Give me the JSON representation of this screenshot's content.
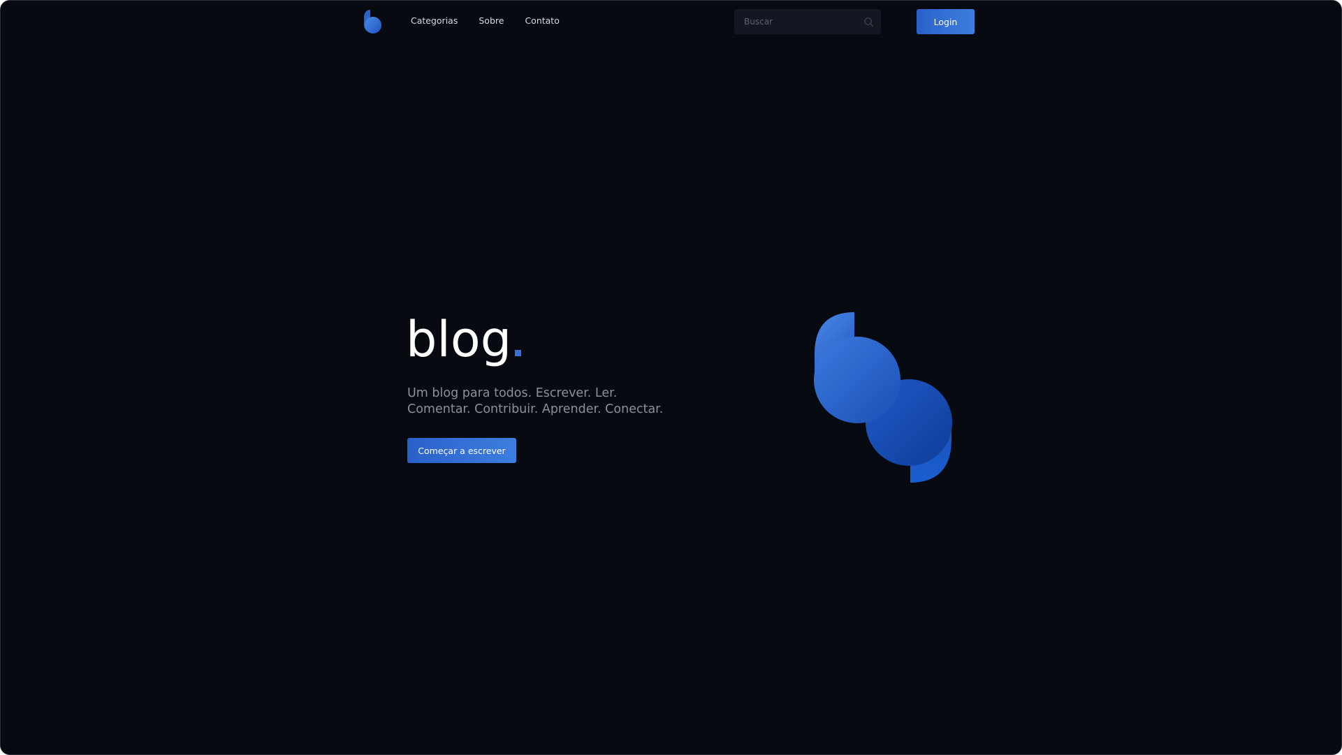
{
  "nav": {
    "logo_icon": "blog-logo-icon",
    "links": [
      {
        "label": "Categorias"
      },
      {
        "label": "Sobre"
      },
      {
        "label": "Contato"
      }
    ],
    "search": {
      "placeholder": "Buscar",
      "value": "",
      "icon": "search-icon"
    },
    "login_label": "Login"
  },
  "hero": {
    "title": "blog",
    "subtitle_lines": [
      "Um blog para todos. Escrever. Ler.",
      "Comentar. Contribuir. Aprender. Conectar."
    ],
    "cta_label": "Começar a escrever",
    "art_icon": "blog-logo-illustration"
  },
  "colors": {
    "background": "#070a11",
    "accent": "#2f6bd6",
    "accent_light": "#3d7ee0",
    "text_primary": "#ffffff",
    "text_muted": "#8a909c"
  }
}
